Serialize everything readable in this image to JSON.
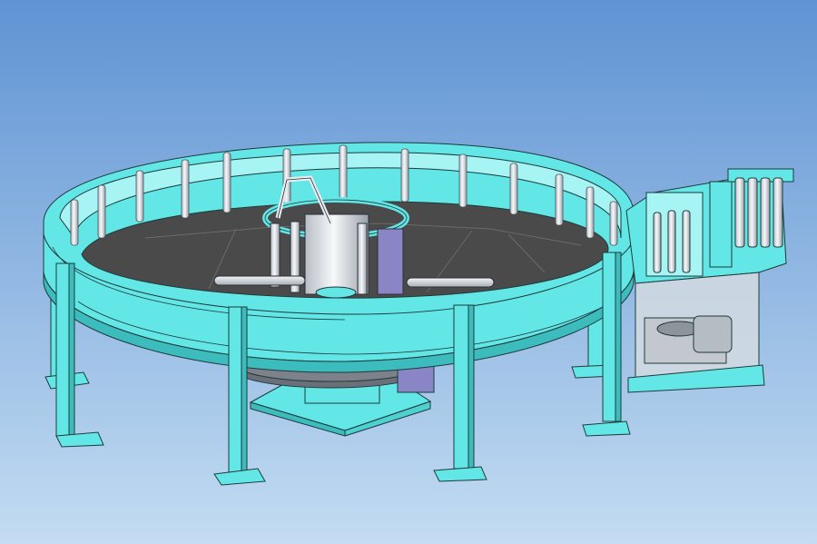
{
  "scene": {
    "subject": "circular-machine-cad-model",
    "colors": {
      "sky_top": "#5f93d3",
      "sky_bottom": "#c3dcf2",
      "frame": "#63e6e6",
      "frame_light": "#a6f4f4",
      "frame_dark": "#3cbcbc",
      "outline": "#1f3a3a",
      "table": "#4a4a4a",
      "table_light": "#5e5e5e",
      "cylinder": "#e4e8ee",
      "cylinder_shade": "#aeb4bc",
      "gear": "#6a6f78",
      "panel_glass": "#d2dae0"
    }
  }
}
